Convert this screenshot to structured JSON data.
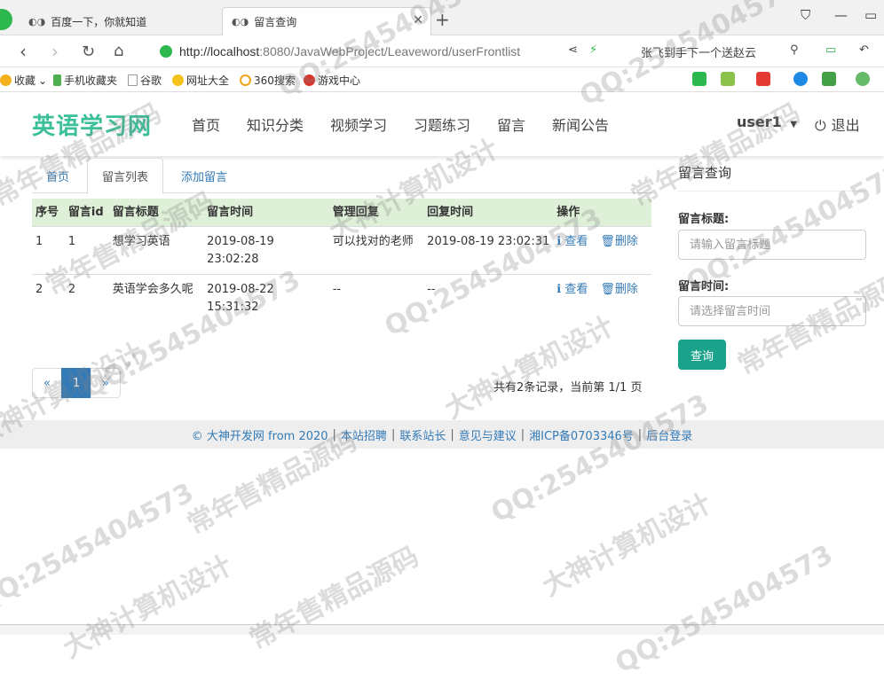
{
  "browser": {
    "tabs": [
      {
        "title": "百度一下，你就知道"
      },
      {
        "title": "留言查询"
      }
    ],
    "url_prefix": "http://",
    "url_host": "localhost",
    "url_path": ":8080/JavaWebProject/Leaveword/userFrontlist",
    "search_hint": "张飞到手下一个送赵云",
    "bookmarks": [
      {
        "label": "收藏",
        "icon": "star-icon"
      },
      {
        "label": "手机收藏夹",
        "icon": "phone-icon"
      },
      {
        "label": "谷歌",
        "icon": "page-icon"
      },
      {
        "label": "网址大全",
        "icon": "compass-icon"
      },
      {
        "label": "360搜索",
        "icon": "search-icon"
      },
      {
        "label": "游戏中心",
        "icon": "game-icon"
      }
    ]
  },
  "site": {
    "brand": "英语学习网",
    "nav": [
      "首页",
      "知识分类",
      "视频学习",
      "习题练习",
      "留言",
      "新闻公告"
    ],
    "user": "user1",
    "logout": "退出"
  },
  "subtabs": [
    "首页",
    "留言列表",
    "添加留言"
  ],
  "table": {
    "headers": [
      "序号",
      "留言id",
      "留言标题",
      "留言时间",
      "管理回复",
      "回复时间",
      "操作"
    ],
    "rows": [
      {
        "no": "1",
        "id": "1",
        "title": "想学习英语",
        "time": "2019-08-19 23:02:28",
        "reply": "可以找对的老师",
        "reply_time": "2019-08-19 23:02:31",
        "view": "查看",
        "delete": "删除"
      },
      {
        "no": "2",
        "id": "2",
        "title": "英语学会多久呢",
        "time": "2019-08-22 15:31:32",
        "reply": "--",
        "reply_time": "--",
        "view": "查看",
        "delete": "删除"
      }
    ]
  },
  "pagination": {
    "prev": "«",
    "current": "1",
    "next": "»"
  },
  "record_info": "共有2条记录，当前第 1/1 页",
  "sidebar": {
    "title": "留言查询",
    "title_label": "留言标题:",
    "title_placeholder": "请输入留言标题",
    "time_label": "留言时间:",
    "time_placeholder": "请选择留言时间",
    "button": "查询"
  },
  "footer": [
    "© 大神开发网 from 2020",
    "本站招聘",
    "联系站长",
    "意见与建议",
    "湘ICP备0703346号",
    "后台登录"
  ],
  "watermarks": [
    "QQ:2545404573",
    "常年售精品源码",
    "大神计算机设计"
  ],
  "colors": {
    "brand": "#3cc09a",
    "header_row": "#dff0d8",
    "link": "#337ab7",
    "button": "#1aa38a"
  }
}
